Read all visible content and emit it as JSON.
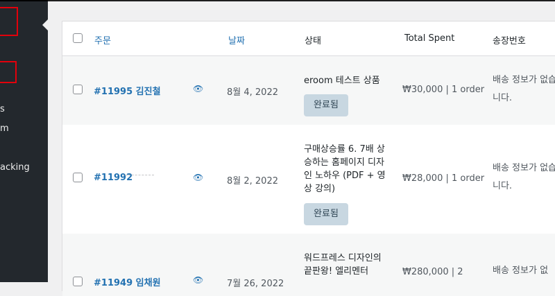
{
  "sidebar": {
    "items": [
      "s",
      "m",
      "acking"
    ]
  },
  "table": {
    "headers": {
      "order": "주문",
      "date": "날짜",
      "status": "상태",
      "total_spent": "Total Spent",
      "invoice": "송장번호"
    },
    "rows": [
      {
        "order": "#11995 김진철",
        "date": "8월 4, 2022",
        "product": "eroom 테스트 상품",
        "status": "완료됨",
        "total_spent": "₩30,000 | 1 order",
        "shipping": "배송 정보가 없습니다."
      },
      {
        "order": "#11992",
        "date": "8월 2, 2022",
        "product": "구매상승률 6. 7배 상승하는 홈페이지 디자인 노하우 (PDF + 영상 강의)",
        "status": "완료됨",
        "total_spent": "₩28,000 | 1 order",
        "shipping": "배송 정보가 없습니다."
      },
      {
        "order": "#11949 임채원",
        "date": "7월 26, 2022",
        "product": "워드프레스 디자인의 끝판왕! 엘리멘터",
        "status": "",
        "total_spent": "₩280,000 | 2",
        "shipping": "배송 정보가 없"
      }
    ]
  }
}
